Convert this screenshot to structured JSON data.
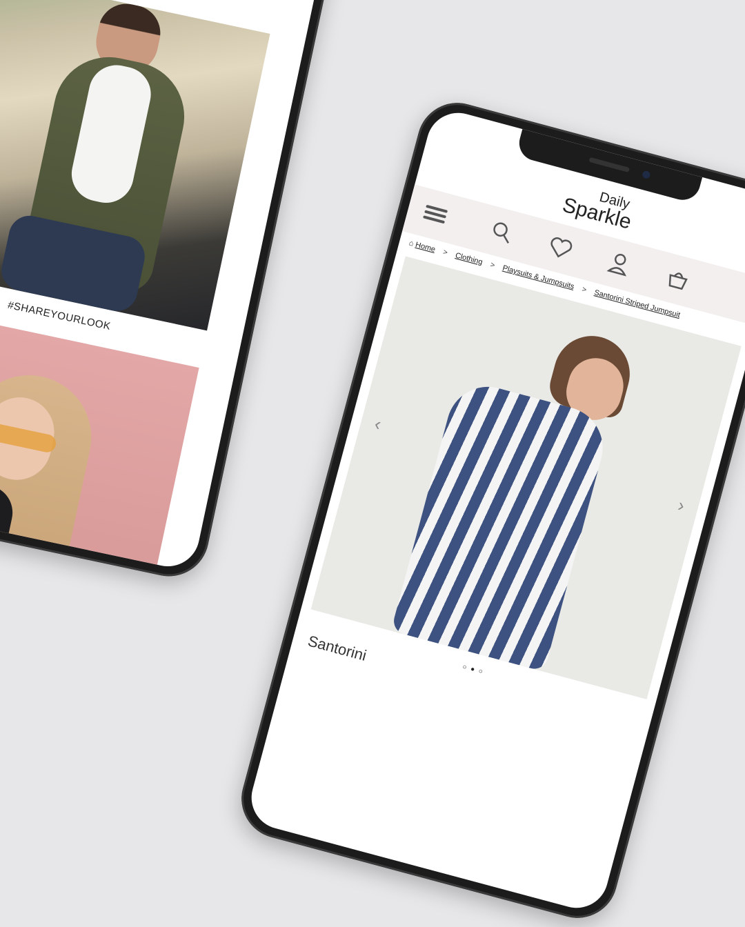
{
  "left_phone": {
    "hashtag": "#SHAREYOURLOOK"
  },
  "right_phone": {
    "logo": {
      "line1": "Daily",
      "line2": "Sparkle"
    },
    "nav_icons": [
      "menu-icon",
      "search-icon",
      "heart-icon",
      "user-icon",
      "basket-icon"
    ],
    "breadcrumb": [
      {
        "label": "Home"
      },
      {
        "label": "Clothing"
      },
      {
        "label": "Playsuits & Jumpsuits"
      },
      {
        "label": "Santorini Striped Jumpsuit"
      }
    ],
    "breadcrumb_separator": ">",
    "gallery": {
      "prev": "‹",
      "next": "›"
    },
    "product_title": "Santorini"
  }
}
